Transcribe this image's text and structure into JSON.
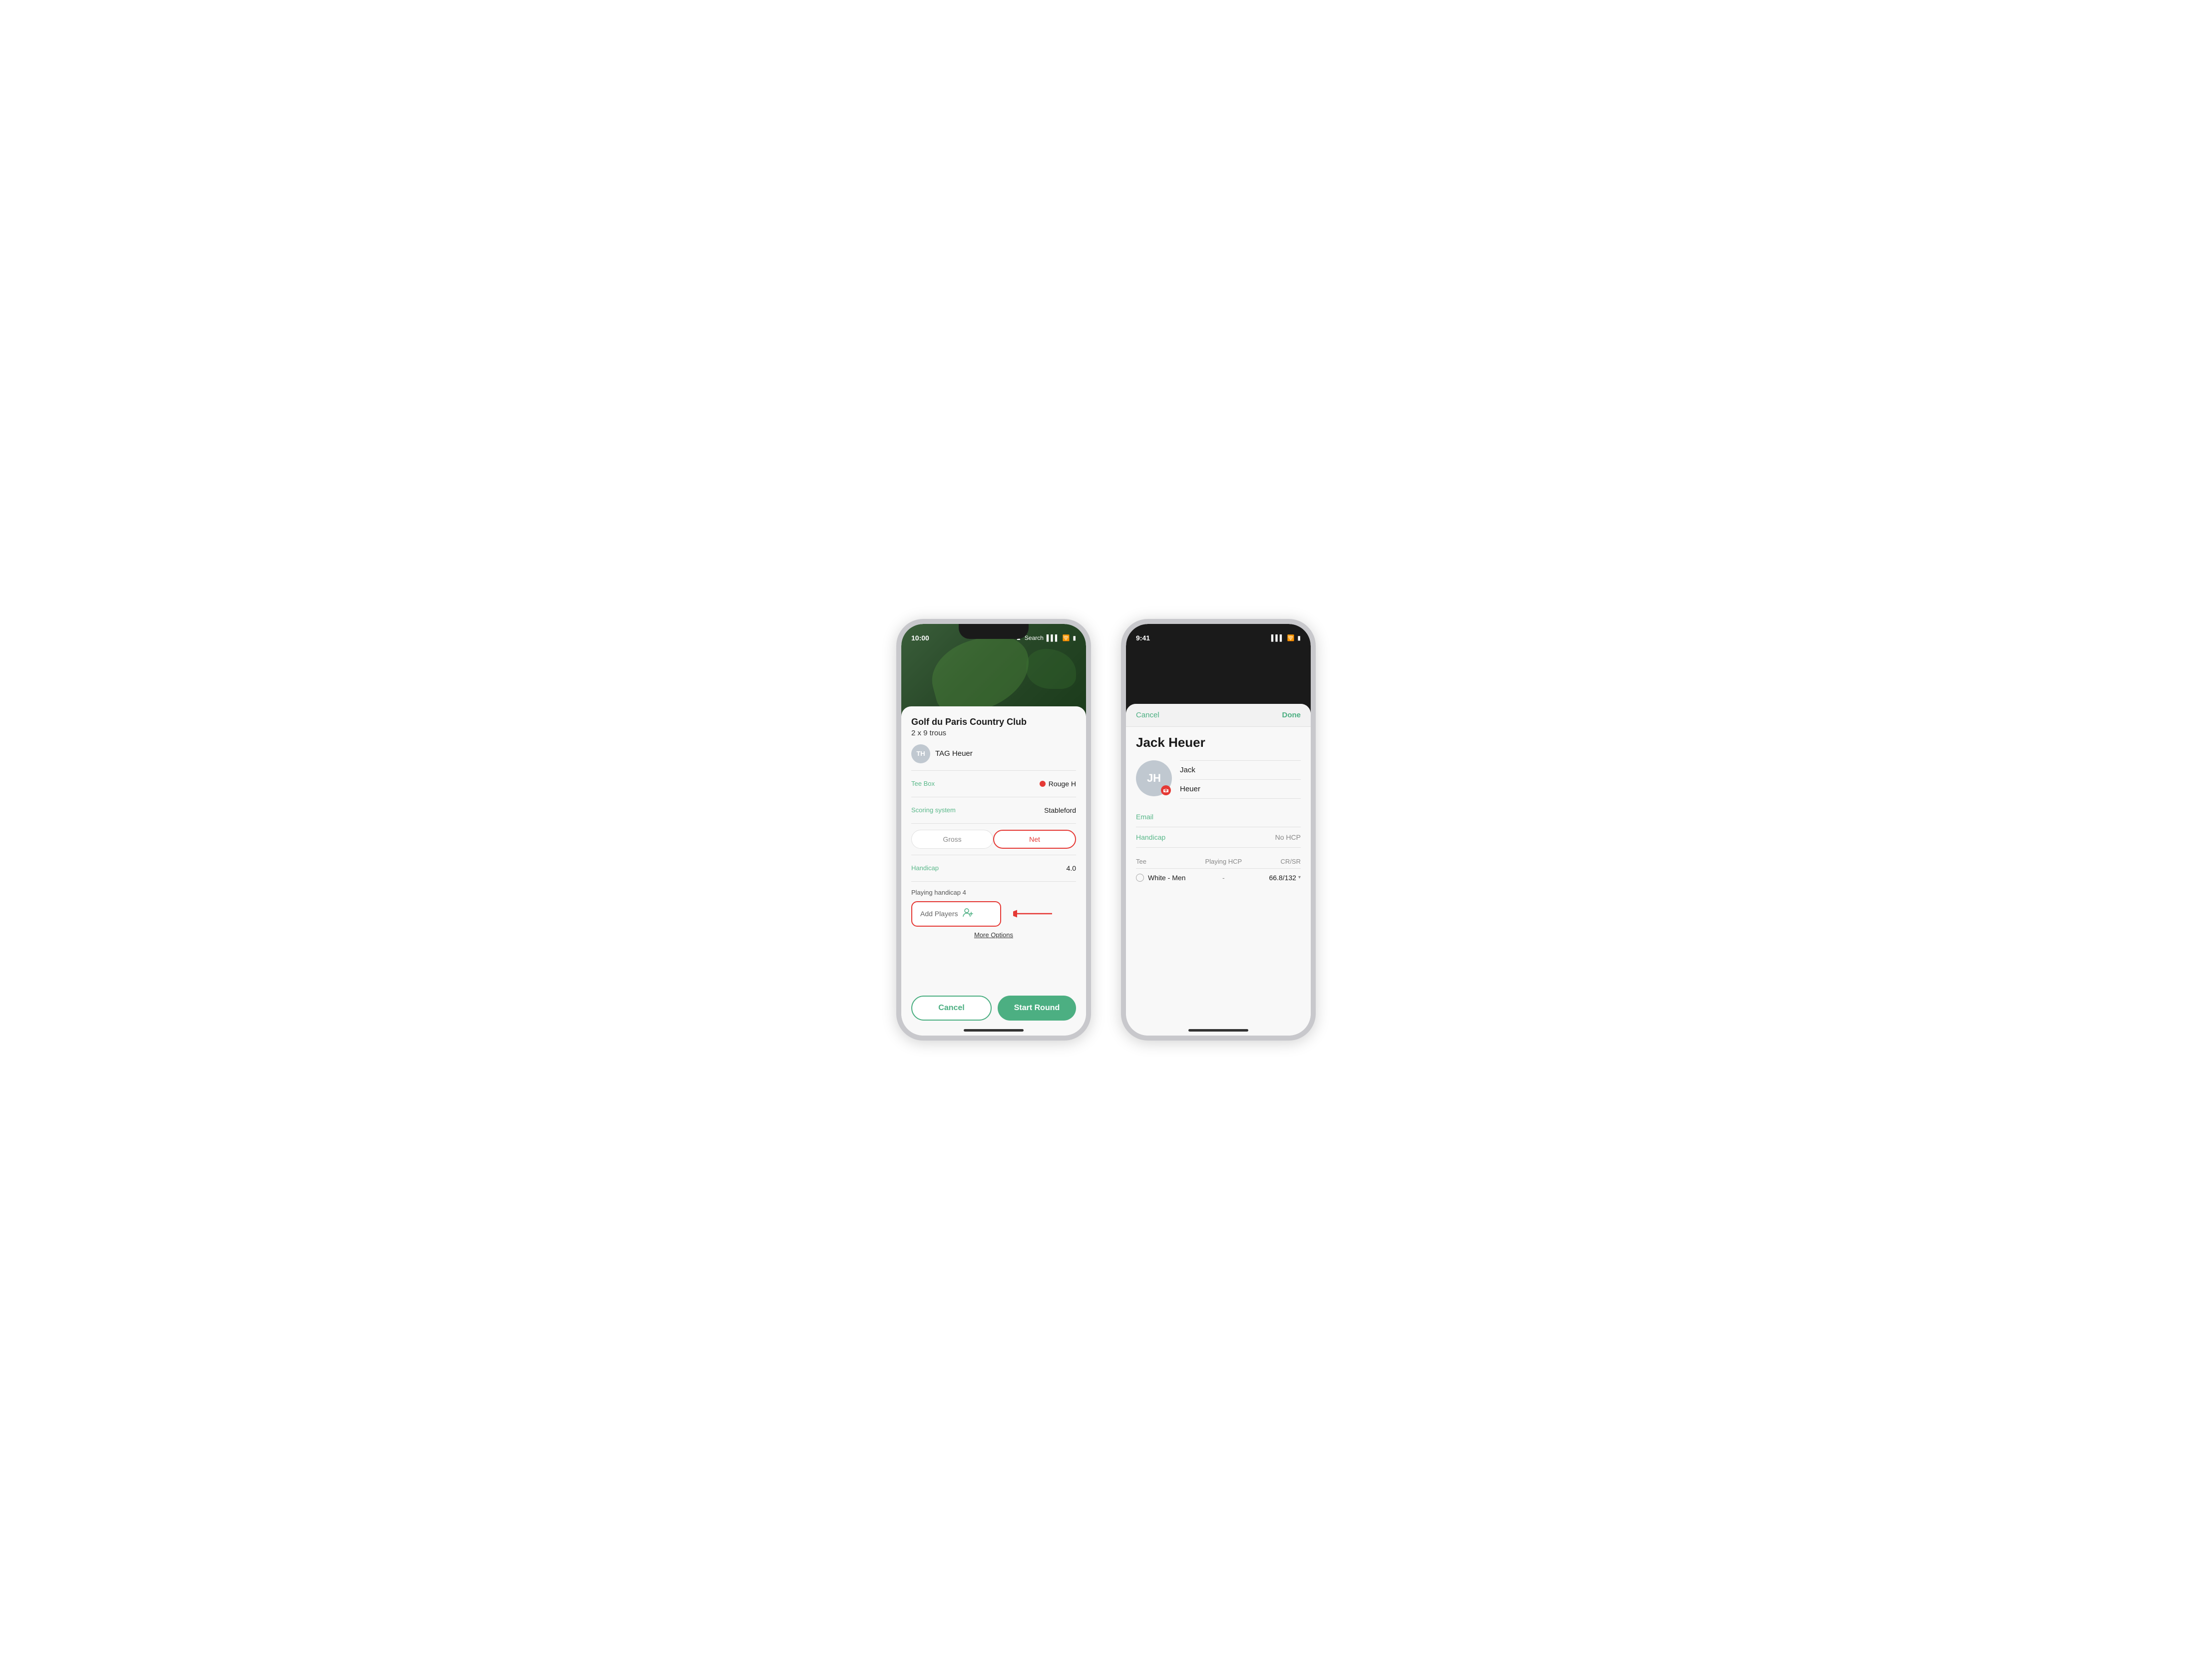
{
  "scene": {
    "phone1": {
      "status": {
        "time": "10:00",
        "search_label": "Search"
      },
      "course": {
        "title": "Golf du Paris Country Club",
        "subtitle": "2 x 9 trous"
      },
      "player": {
        "initials": "TH",
        "name": "TAG Heuer"
      },
      "settings": {
        "tee_box_label": "Tee Box",
        "tee_box_value": "Rouge H",
        "scoring_label": "Scoring system",
        "scoring_value": "Stableford",
        "gross_label": "Gross",
        "net_label": "Net",
        "handicap_label": "Handicap",
        "handicap_value": "4.0",
        "playing_handicap_label": "Playing handicap  4"
      },
      "add_players": {
        "label": "Add Players",
        "icon": "👤+"
      },
      "more_options_label": "More Options",
      "buttons": {
        "cancel_label": "Cancel",
        "start_label": "Start Round"
      }
    },
    "phone2": {
      "status": {
        "time": "9:41"
      },
      "header": {
        "cancel_label": "Cancel",
        "done_label": "Done"
      },
      "player": {
        "name_large": "Jack Heuer",
        "initials": "JH",
        "first_name": "Jack",
        "last_name": "Heuer",
        "email_label": "Email",
        "email_value": "",
        "handicap_label": "Handicap",
        "handicap_value": "No HCP"
      },
      "tee_table": {
        "col1": "Tee",
        "col2": "Playing HCP",
        "col3": "CR/SR",
        "row": {
          "name": "White - Men",
          "hcp": "-",
          "crsr": "66.8/132"
        }
      }
    }
  }
}
